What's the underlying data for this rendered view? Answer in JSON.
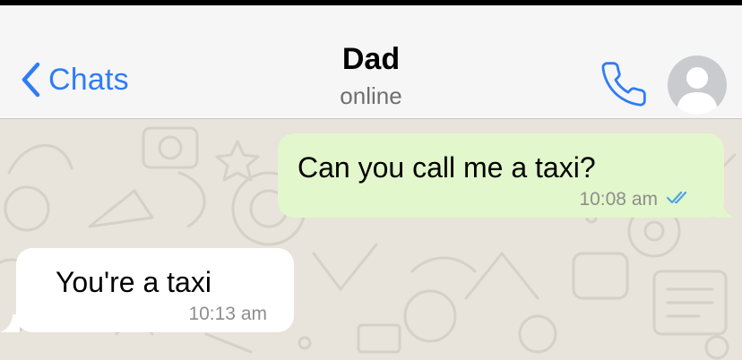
{
  "header": {
    "back_label": "Chats",
    "contact_name": "Dad",
    "contact_status": "online"
  },
  "messages": [
    {
      "direction": "outgoing",
      "text": "Can you call me a taxi?",
      "time": "10:08 am",
      "status": "read"
    },
    {
      "direction": "incoming",
      "text": "You're a taxi",
      "time": "10:13 am"
    }
  ],
  "colors": {
    "accent": "#2f7cf6",
    "outgoing_bubble": "#e2f7cb",
    "incoming_bubble": "#ffffff",
    "chat_background": "#e8e3db",
    "read_ticks": "#4fa3e6"
  },
  "icons": {
    "back": "chevron-left-icon",
    "call": "phone-icon",
    "avatar": "default-person-icon",
    "read_receipt": "double-check-icon"
  }
}
